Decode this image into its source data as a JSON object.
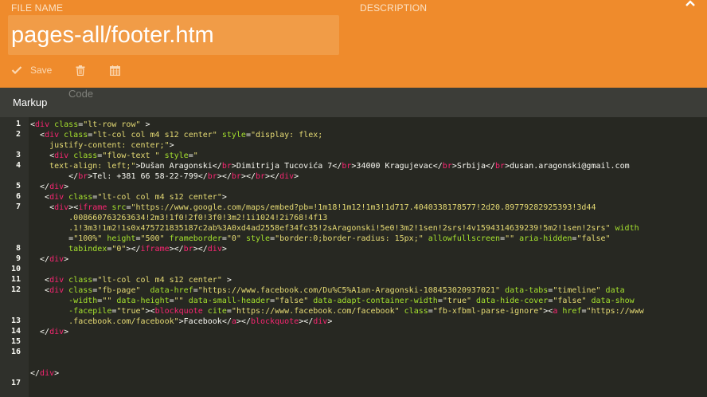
{
  "header": {
    "file_name_label": "FILE NAME",
    "description_label": "DESCRIPTION",
    "file_name_value": "pages-all/footer.htm",
    "save_label": "Save",
    "bg_color": "#ef8b2c"
  },
  "tabs": {
    "markup": "Markup",
    "code": "Code"
  },
  "icons": [
    "chevron-up-icon",
    "check-icon",
    "trash-icon",
    "calendar-icon"
  ],
  "editor": {
    "line_numbers": [
      "1",
      "2",
      "3",
      "4",
      "5",
      "6",
      "7",
      "8",
      "9",
      "10",
      "11",
      "12",
      "13",
      "14",
      "15",
      "16",
      "17"
    ],
    "colors": {
      "tag": "#f92672",
      "attr": "#a6e22e",
      "string": "#e6db74",
      "text": "#f8f8f2",
      "background": "#272822"
    },
    "lines": [
      [
        [
          "<",
          "p"
        ],
        [
          "div",
          "t"
        ],
        [
          " class",
          "a"
        ],
        [
          "=",
          "p"
        ],
        [
          "\"lt-row row\"",
          "s"
        ],
        [
          " >",
          "p"
        ]
      ],
      [
        [
          "  <",
          "p"
        ],
        [
          "div",
          "t"
        ],
        [
          " class",
          "a"
        ],
        [
          "=",
          "p"
        ],
        [
          "\"lt-col col m4 s12 center\"",
          "s"
        ],
        [
          " style",
          "a"
        ],
        [
          "=",
          "p"
        ],
        [
          "\"display: flex;",
          "s"
        ]
      ],
      [
        [
          "    justify-content: center;\"",
          "s"
        ],
        [
          ">",
          "p"
        ]
      ],
      [
        [
          "    <",
          "p"
        ],
        [
          "div",
          "t"
        ],
        [
          " class",
          "a"
        ],
        [
          "=",
          "p"
        ],
        [
          "\"flow-text \"",
          "s"
        ],
        [
          " style",
          "a"
        ],
        [
          "=",
          "p"
        ],
        [
          "\"",
          "s"
        ]
      ],
      [
        [
          "    text-align: left;\"",
          "s"
        ],
        [
          ">Dušan Aragonski</",
          "p"
        ],
        [
          "br",
          "t"
        ],
        [
          ">Dimitrija Tucovića 7</",
          "p"
        ],
        [
          "br",
          "t"
        ],
        [
          ">34000 Kragujevac</",
          "p"
        ],
        [
          "br",
          "t"
        ],
        [
          ">Srbija</",
          "p"
        ],
        [
          "br",
          "t"
        ],
        [
          ">dusan.aragonski@gmail.com",
          "p"
        ]
      ],
      [
        [
          "        </",
          "p"
        ],
        [
          "br",
          "t"
        ],
        [
          ">Tel: +381 66 58-22-799</",
          "p"
        ],
        [
          "br",
          "t"
        ],
        [
          "></",
          "p"
        ],
        [
          "br",
          "t"
        ],
        [
          "></",
          "p"
        ],
        [
          "br",
          "t"
        ],
        [
          "></",
          "p"
        ],
        [
          "div",
          "t"
        ],
        [
          ">",
          "p"
        ]
      ],
      [
        [
          "  </",
          "p"
        ],
        [
          "div",
          "t"
        ],
        [
          ">",
          "p"
        ]
      ],
      [
        [
          "   <",
          "p"
        ],
        [
          "div",
          "t"
        ],
        [
          " class",
          "a"
        ],
        [
          "=",
          "p"
        ],
        [
          "\"lt-col col m4 s12 center\"",
          "s"
        ],
        [
          ">",
          "p"
        ]
      ],
      [
        [
          "    <",
          "p"
        ],
        [
          "div",
          "t"
        ],
        [
          "><",
          "p"
        ],
        [
          "iframe",
          "t"
        ],
        [
          " src",
          "a"
        ],
        [
          "=",
          "p"
        ],
        [
          "\"https://www.google.com/maps/embed?pb=!1m18!1m12!1m3!1d717.4040338178577!2d20.89779282925393!3d44",
          "s"
        ]
      ],
      [
        [
          "        .008660763263634!2m3!1f0!2f0!3f0!3m2!1i1024!2i768!4f13",
          "s"
        ]
      ],
      [
        [
          "        .1!3m3!1m2!1s0x475721835187c2ab%3A0xd4ad2558ef34fc35!2sAragonski!5e0!3m2!1sen!2srs!4v1594314639239!5m2!1sen!2srs\"",
          "s"
        ],
        [
          " width",
          "a"
        ]
      ],
      [
        [
          "        =",
          "p"
        ],
        [
          "\"100%\"",
          "s"
        ],
        [
          " height",
          "a"
        ],
        [
          "=",
          "p"
        ],
        [
          "\"500\"",
          "s"
        ],
        [
          " frameborder",
          "a"
        ],
        [
          "=",
          "p"
        ],
        [
          "\"0\"",
          "s"
        ],
        [
          " style",
          "a"
        ],
        [
          "=",
          "p"
        ],
        [
          "\"border:0;border-radius: 15px;\"",
          "s"
        ],
        [
          " allowfullscreen",
          "a"
        ],
        [
          "=",
          "p"
        ],
        [
          "\"\"",
          "s"
        ],
        [
          " aria-hidden",
          "a"
        ],
        [
          "=",
          "p"
        ],
        [
          "\"false\"",
          "s"
        ]
      ],
      [
        [
          "        tabindex",
          "a"
        ],
        [
          "=",
          "p"
        ],
        [
          "\"0\"",
          "s"
        ],
        [
          "></",
          "p"
        ],
        [
          "iframe",
          "t"
        ],
        [
          "></",
          "p"
        ],
        [
          "br",
          "t"
        ],
        [
          "></",
          "p"
        ],
        [
          "div",
          "t"
        ],
        [
          ">",
          "p"
        ]
      ],
      [
        [
          "  </",
          "p"
        ],
        [
          "div",
          "t"
        ],
        [
          ">",
          "p"
        ]
      ],
      [
        [
          "",
          "p"
        ]
      ],
      [
        [
          "   <",
          "p"
        ],
        [
          "div",
          "t"
        ],
        [
          " class",
          "a"
        ],
        [
          "=",
          "p"
        ],
        [
          "\"lt-col col m4 s12 center\"",
          "s"
        ],
        [
          " >",
          "p"
        ]
      ],
      [
        [
          "   <",
          "p"
        ],
        [
          "div",
          "t"
        ],
        [
          " class",
          "a"
        ],
        [
          "=",
          "p"
        ],
        [
          "\"fb-page\"",
          "s"
        ],
        [
          "  data-href",
          "a"
        ],
        [
          "=",
          "p"
        ],
        [
          "\"https://www.facebook.com/Du%C5%A1an-Aragonski-108453020937021\"",
          "s"
        ],
        [
          " data-tabs",
          "a"
        ],
        [
          "=",
          "p"
        ],
        [
          "\"timeline\"",
          "s"
        ],
        [
          " data",
          "a"
        ]
      ],
      [
        [
          "        -width",
          "a"
        ],
        [
          "=",
          "p"
        ],
        [
          "\"\"",
          "s"
        ],
        [
          " data-height",
          "a"
        ],
        [
          "=",
          "p"
        ],
        [
          "\"\"",
          "s"
        ],
        [
          " data-small-header",
          "a"
        ],
        [
          "=",
          "p"
        ],
        [
          "\"false\"",
          "s"
        ],
        [
          " data-adapt-container-width",
          "a"
        ],
        [
          "=",
          "p"
        ],
        [
          "\"true\"",
          "s"
        ],
        [
          " data-hide-cover",
          "a"
        ],
        [
          "=",
          "p"
        ],
        [
          "\"false\"",
          "s"
        ],
        [
          " data-show",
          "a"
        ]
      ],
      [
        [
          "        -facepile",
          "a"
        ],
        [
          "=",
          "p"
        ],
        [
          "\"true\"",
          "s"
        ],
        [
          "><",
          "p"
        ],
        [
          "blockquote",
          "t"
        ],
        [
          " cite",
          "a"
        ],
        [
          "=",
          "p"
        ],
        [
          "\"https://www.facebook.com/facebook\"",
          "s"
        ],
        [
          " class",
          "a"
        ],
        [
          "=",
          "p"
        ],
        [
          "\"fb-xfbml-parse-ignore\"",
          "s"
        ],
        [
          "><",
          "p"
        ],
        [
          "a",
          "t"
        ],
        [
          " href",
          "a"
        ],
        [
          "=",
          "p"
        ],
        [
          "\"https://www",
          "s"
        ]
      ],
      [
        [
          "        .facebook.com/facebook\"",
          "s"
        ],
        [
          ">Facebook</",
          "p"
        ],
        [
          "a",
          "t"
        ],
        [
          "></",
          "p"
        ],
        [
          "blockquote",
          "t"
        ],
        [
          "></",
          "p"
        ],
        [
          "div",
          "t"
        ],
        [
          ">",
          "p"
        ]
      ],
      [
        [
          "  </",
          "p"
        ],
        [
          "div",
          "t"
        ],
        [
          ">",
          "p"
        ]
      ],
      [
        [
          "",
          "p"
        ]
      ],
      [
        [
          "",
          "p"
        ]
      ],
      [
        [
          "",
          "p"
        ]
      ],
      [
        [
          "</",
          "p"
        ],
        [
          "div",
          "t"
        ],
        [
          ">",
          "p"
        ]
      ]
    ]
  }
}
